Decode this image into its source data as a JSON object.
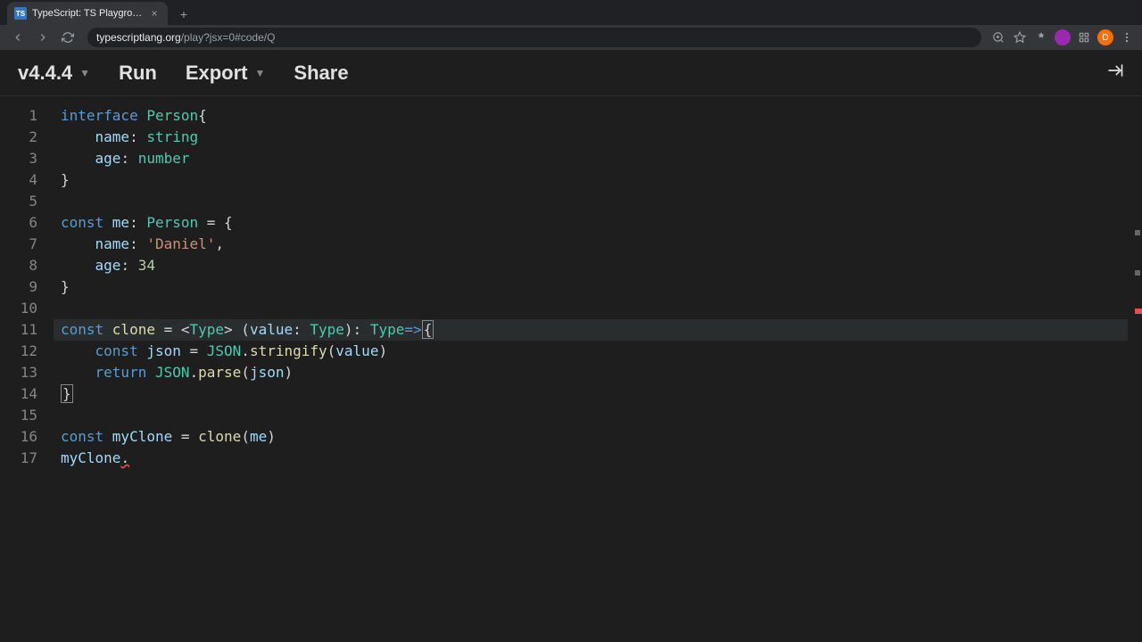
{
  "browser": {
    "tab": {
      "favicon_text": "TS",
      "title": "TypeScript: TS Playground - A"
    },
    "url": {
      "domain": "typescriptlang.org",
      "path": "/play?jsx=0#code/Q"
    },
    "avatar_letter": "D"
  },
  "playground": {
    "version": "v4.4.4",
    "run": "Run",
    "export": "Export",
    "share": "Share"
  },
  "editor": {
    "line_count": 17,
    "current_line": 11,
    "lines": [
      [
        {
          "t": "interface ",
          "c": "kw"
        },
        {
          "t": "Person",
          "c": "type"
        },
        {
          "t": "{",
          "c": "punct"
        }
      ],
      [
        {
          "t": "    ",
          "c": ""
        },
        {
          "t": "name",
          "c": "ident"
        },
        {
          "t": ": ",
          "c": "punct"
        },
        {
          "t": "string",
          "c": "type"
        }
      ],
      [
        {
          "t": "    ",
          "c": ""
        },
        {
          "t": "age",
          "c": "ident"
        },
        {
          "t": ": ",
          "c": "punct"
        },
        {
          "t": "number",
          "c": "type"
        }
      ],
      [
        {
          "t": "}",
          "c": "punct"
        }
      ],
      [],
      [
        {
          "t": "const ",
          "c": "kw"
        },
        {
          "t": "me",
          "c": "ident"
        },
        {
          "t": ": ",
          "c": "punct"
        },
        {
          "t": "Person",
          "c": "type"
        },
        {
          "t": " = {",
          "c": "punct"
        }
      ],
      [
        {
          "t": "    ",
          "c": ""
        },
        {
          "t": "name",
          "c": "ident"
        },
        {
          "t": ": ",
          "c": "punct"
        },
        {
          "t": "'Daniel'",
          "c": "str"
        },
        {
          "t": ",",
          "c": "punct"
        }
      ],
      [
        {
          "t": "    ",
          "c": ""
        },
        {
          "t": "age",
          "c": "ident"
        },
        {
          "t": ": ",
          "c": "punct"
        },
        {
          "t": "34",
          "c": "num"
        }
      ],
      [
        {
          "t": "}",
          "c": "punct"
        }
      ],
      [],
      [
        {
          "t": "const ",
          "c": "kw"
        },
        {
          "t": "clone",
          "c": "fn"
        },
        {
          "t": " = <",
          "c": "punct"
        },
        {
          "t": "Type",
          "c": "type"
        },
        {
          "t": "> (",
          "c": "punct"
        },
        {
          "t": "value",
          "c": "ident"
        },
        {
          "t": ": ",
          "c": "punct"
        },
        {
          "t": "Type",
          "c": "type"
        },
        {
          "t": "): ",
          "c": "punct"
        },
        {
          "t": "Type",
          "c": "type"
        },
        {
          "t": "=>",
          "c": "kw"
        },
        {
          "t": "{",
          "c": "punct bracket-match"
        }
      ],
      [
        {
          "t": "    ",
          "c": ""
        },
        {
          "t": "const ",
          "c": "kw"
        },
        {
          "t": "json",
          "c": "ident"
        },
        {
          "t": " = ",
          "c": "punct"
        },
        {
          "t": "JSON",
          "c": "cls"
        },
        {
          "t": ".",
          "c": "punct"
        },
        {
          "t": "stringify",
          "c": "fn"
        },
        {
          "t": "(",
          "c": "punct"
        },
        {
          "t": "value",
          "c": "ident"
        },
        {
          "t": ")",
          "c": "punct"
        }
      ],
      [
        {
          "t": "    ",
          "c": ""
        },
        {
          "t": "return ",
          "c": "kw"
        },
        {
          "t": "JSON",
          "c": "cls"
        },
        {
          "t": ".",
          "c": "punct"
        },
        {
          "t": "parse",
          "c": "fn"
        },
        {
          "t": "(",
          "c": "punct"
        },
        {
          "t": "json",
          "c": "ident"
        },
        {
          "t": ")",
          "c": "punct"
        }
      ],
      [
        {
          "t": "}",
          "c": "punct bracket-match"
        }
      ],
      [],
      [
        {
          "t": "const ",
          "c": "kw"
        },
        {
          "t": "myClone",
          "c": "ident"
        },
        {
          "t": " = ",
          "c": "punct"
        },
        {
          "t": "clone",
          "c": "fn"
        },
        {
          "t": "(",
          "c": "punct"
        },
        {
          "t": "me",
          "c": "ident"
        },
        {
          "t": ")",
          "c": "punct"
        }
      ],
      [
        {
          "t": "myClone",
          "c": "ident"
        },
        {
          "t": ".",
          "c": "punct err-squiggle"
        }
      ]
    ]
  }
}
